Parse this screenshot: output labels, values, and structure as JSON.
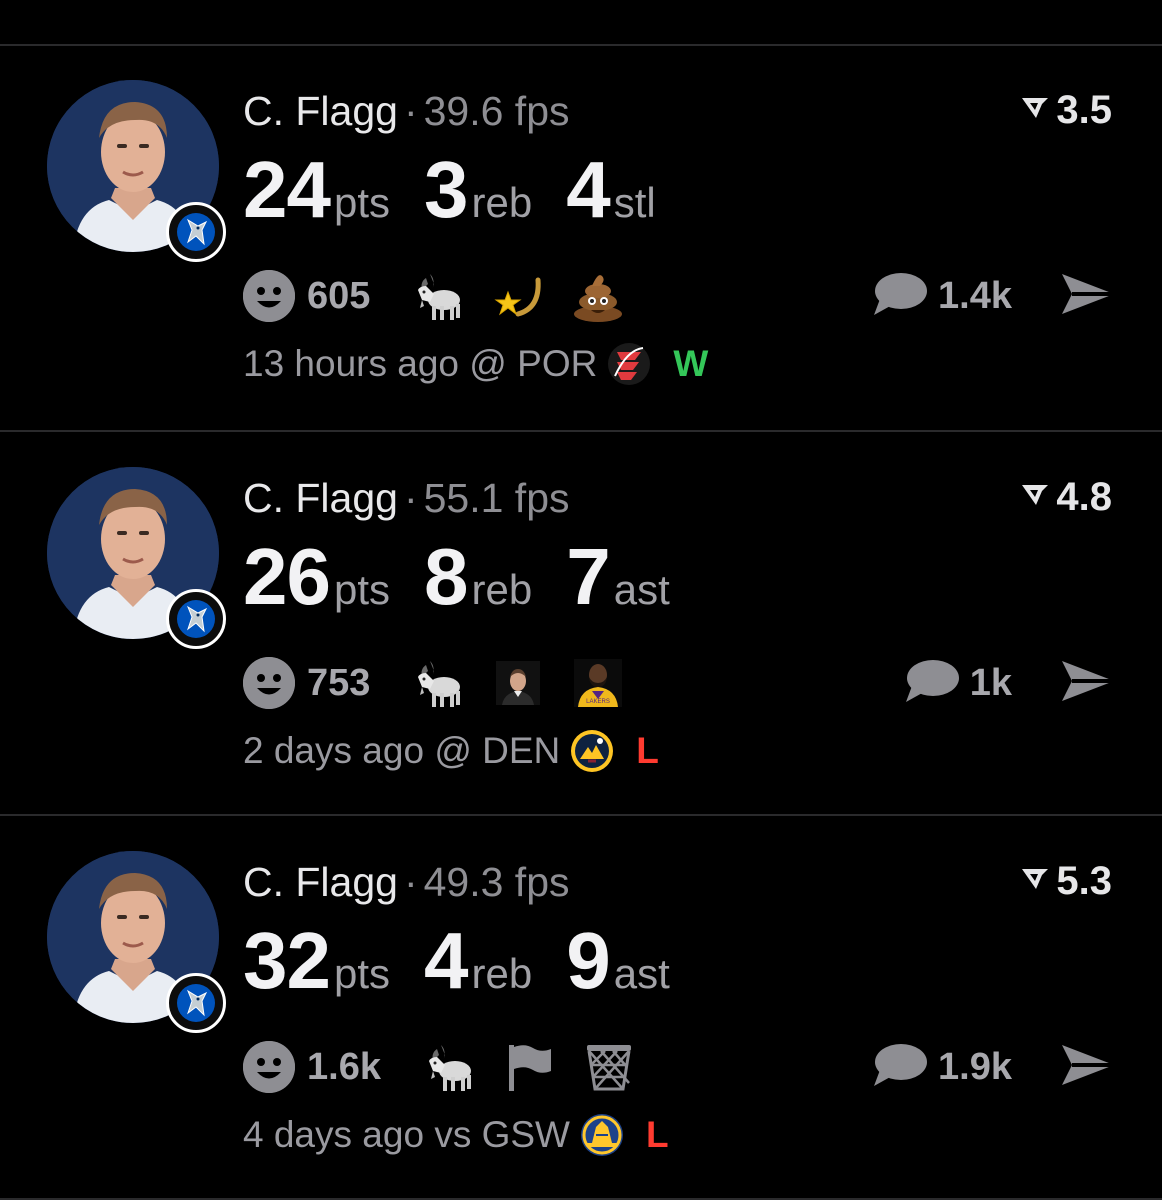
{
  "colors": {
    "win": "#34c759",
    "loss": "#ff3b30",
    "muted": "#8e8e93",
    "avatar_bg": "#1d3461"
  },
  "cards": [
    {
      "player": "C. Flagg",
      "fps": "39.6 fps",
      "rating": "3.5",
      "stats": [
        {
          "value": "24",
          "unit": "pts"
        },
        {
          "value": "3",
          "unit": "reb"
        },
        {
          "value": "4",
          "unit": "stl"
        }
      ],
      "reaction_count": "605",
      "reaction_emojis": [
        "goat-emoji",
        "shooting-star-emoji",
        "poop-emoji"
      ],
      "comment_count": "1.4k",
      "time": "13 hours ago",
      "venue": "@ POR",
      "opponent_logo": "trail-blazers-logo",
      "result": "W"
    },
    {
      "player": "C. Flagg",
      "fps": "55.1 fps",
      "rating": "4.8",
      "stats": [
        {
          "value": "26",
          "unit": "pts"
        },
        {
          "value": "8",
          "unit": "reb"
        },
        {
          "value": "7",
          "unit": "ast"
        }
      ],
      "reaction_count": "753",
      "reaction_emojis": [
        "goat-emoji",
        "person-sticker",
        "lakers-player-sticker"
      ],
      "comment_count": "1k",
      "time": "2 days ago",
      "venue": "@ DEN",
      "opponent_logo": "nuggets-logo",
      "result": "L"
    },
    {
      "player": "C. Flagg",
      "fps": "49.3 fps",
      "rating": "5.3",
      "stats": [
        {
          "value": "32",
          "unit": "pts"
        },
        {
          "value": "4",
          "unit": "reb"
        },
        {
          "value": "9",
          "unit": "ast"
        }
      ],
      "reaction_count": "1.6k",
      "reaction_emojis": [
        "goat-emoji",
        "flag-emoji",
        "basketball-net-emoji"
      ],
      "comment_count": "1.9k",
      "time": "4 days ago",
      "venue": "vs GSW",
      "opponent_logo": "warriors-logo",
      "result": "L"
    }
  ]
}
